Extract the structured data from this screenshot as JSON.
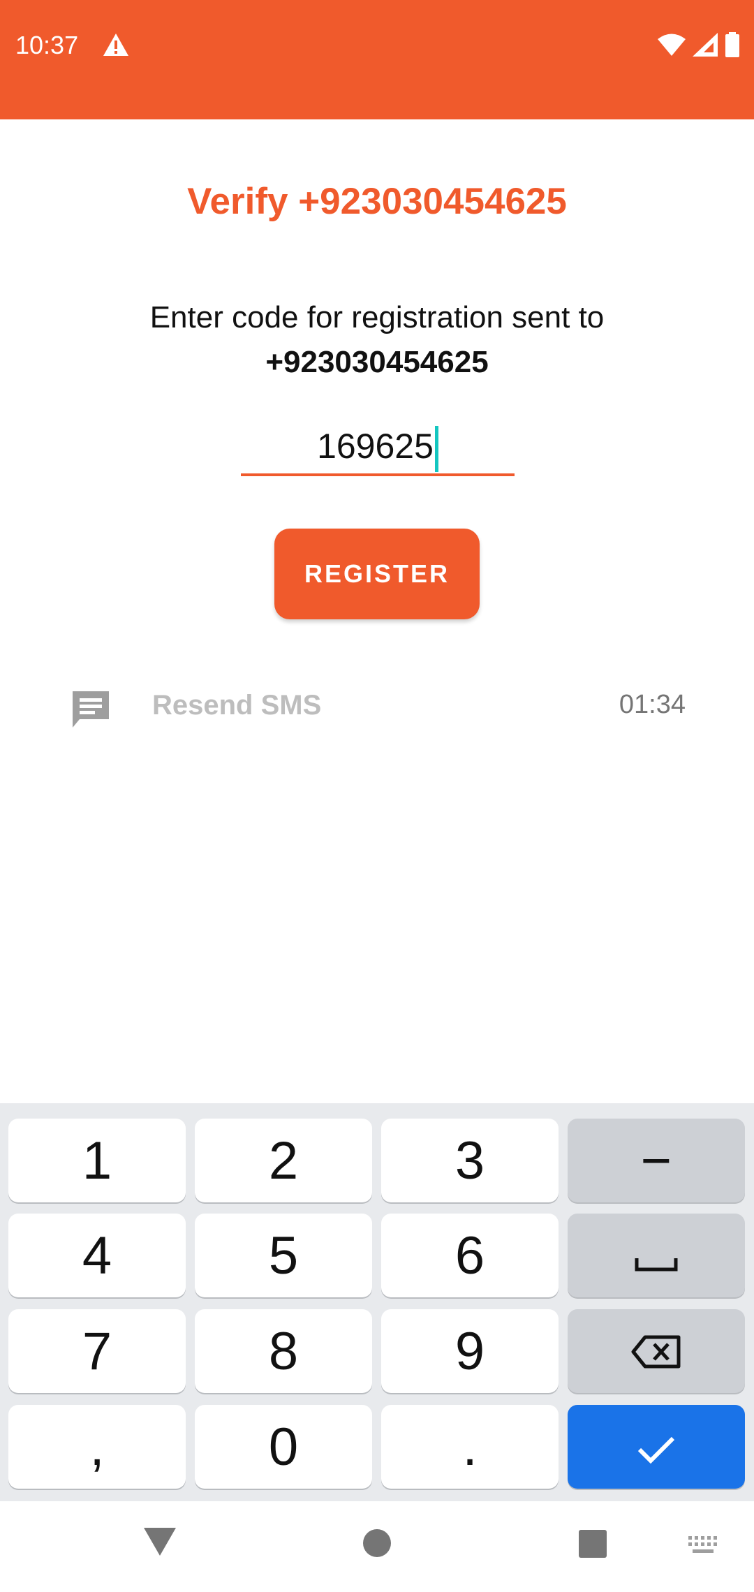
{
  "status_bar": {
    "time": "10:37",
    "background": "#F05A2C"
  },
  "verify": {
    "title": "Verify +923030454625",
    "subtitle": "Enter code for registration sent to",
    "phone": "+923030454625",
    "code_value": "169625"
  },
  "register_button": {
    "label": "REGISTER"
  },
  "resend": {
    "label": "Resend SMS",
    "timer": "01:34",
    "icon": "message-icon"
  },
  "keyboard": {
    "keys": [
      "1",
      "2",
      "3",
      "4",
      "5",
      "6",
      "7",
      "8",
      "9",
      ",",
      "0",
      "."
    ],
    "minus": "−",
    "space_icon": "space-icon",
    "backspace_icon": "backspace-icon",
    "done_icon": "check-icon"
  },
  "nav": {
    "back_icon": "back-triangle-icon",
    "home_icon": "home-circle-icon",
    "recents_icon": "recents-square-icon",
    "keyboard_icon": "keyboard-icon"
  },
  "colors": {
    "accent": "#F05A2C",
    "cursor": "#14C6C0",
    "done_key": "#1A73E8",
    "muted_text": "#BDBDBD"
  }
}
